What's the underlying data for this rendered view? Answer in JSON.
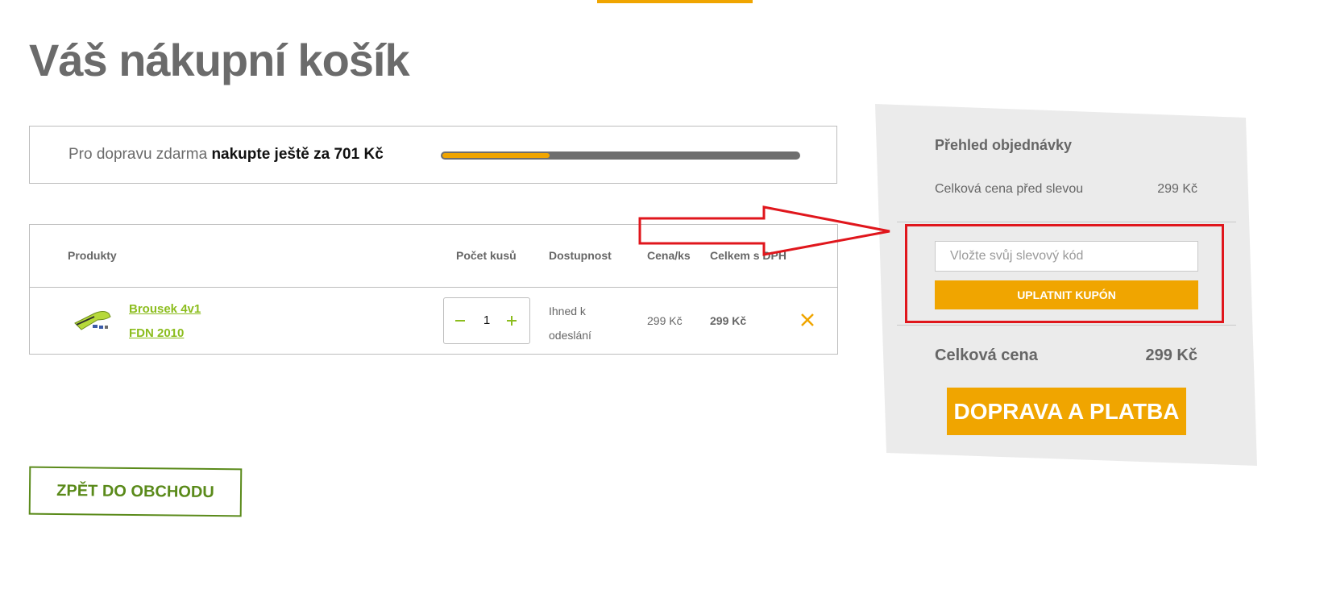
{
  "page_title": "Váš nákupní košík",
  "shipping": {
    "prefix": "Pro dopravu zdarma",
    "bold": "nakupte ještě za 701 Kč",
    "progress_fraction": 0.3
  },
  "table": {
    "headers": {
      "products": "Produkty",
      "quantity": "Počet kusů",
      "availability": "Dostupnost",
      "unit_price": "Cena/ks",
      "total_vat": "Celkem s DPH"
    },
    "rows": [
      {
        "name_line1": "Brousek 4v1",
        "name_line2": "FDN 2010",
        "quantity": "1",
        "availability": "Ihned k odeslání",
        "unit_price": "299 Kč",
        "total": "299 Kč"
      }
    ]
  },
  "back_button": "ZPĚT DO OBCHODU",
  "summary": {
    "title": "Přehled objednávky",
    "subtotal_label": "Celková cena před slevou",
    "subtotal_value": "299 Kč",
    "coupon_placeholder": "Vložte svůj slevový kód",
    "coupon_button": "UPLATNIT KUPÓN",
    "total_label": "Celková cena",
    "total_value": "299 Kč",
    "checkout_button": "DOPRAVA A PLATBA"
  },
  "colors": {
    "accent": "#f0a500",
    "link_green": "#8cbd1e",
    "back_green": "#5a8a1a",
    "annotation_red": "#e0161c"
  },
  "icons": {
    "qty_minus": "minus-icon",
    "qty_plus": "plus-icon",
    "remove": "close-icon"
  }
}
